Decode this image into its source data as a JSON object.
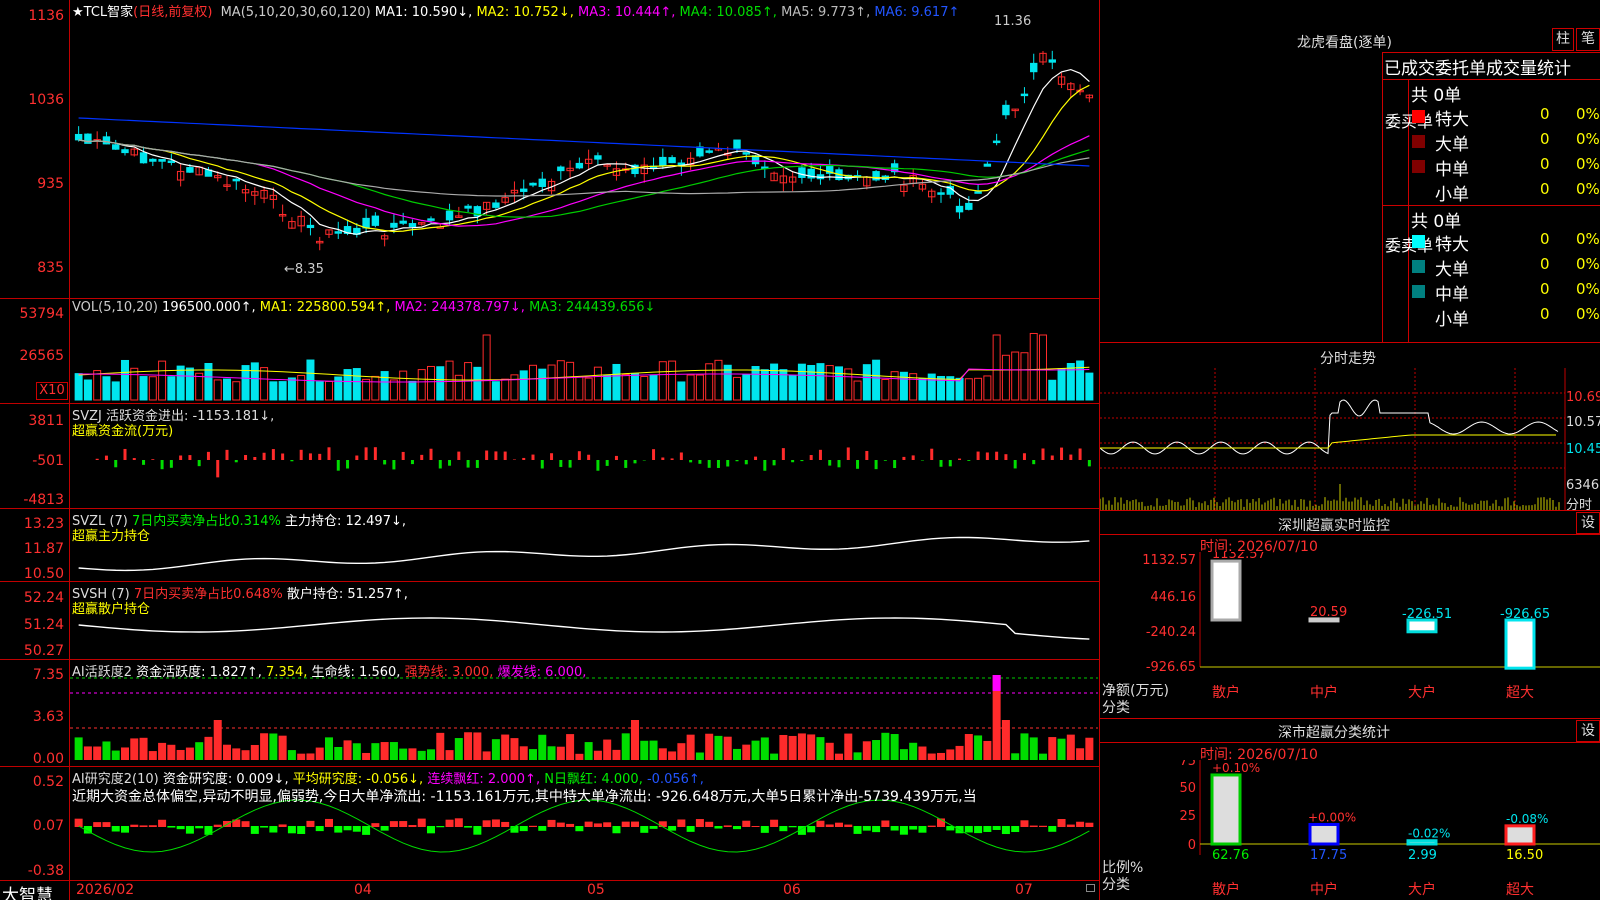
{
  "colors": {
    "up": "#ff2b2b",
    "down": "#00e5ee",
    "grid": "#c00000",
    "ma1": "#ffffff",
    "ma2": "#ffff00",
    "ma3": "#ff00ff",
    "ma4": "#00cc00",
    "ma5": "#aaaaaa",
    "ma6": "#0033ff"
  },
  "main": {
    "stock": "★TCL智家",
    "mode": "(日线,前复权)",
    "ma_label": "MA(5,10,20,30,60,120)",
    "ma1": "MA1: 10.590↓,",
    "ma2": "MA2: 10.752↓,",
    "ma3": "MA3: 10.444↑,",
    "ma4": "MA4: 10.085↑,",
    "ma5": "MA5: 9.773↑,",
    "ma6": "MA6: 9.617↑",
    "high_mark": "11.36",
    "low_mark": "←8.35",
    "yticks": [
      "1136",
      "1036",
      "935",
      "835"
    ]
  },
  "vol": {
    "label": "VOL(5,10,20)",
    "value": "196500.000↑,",
    "ma1": "MA1: 225800.594↑,",
    "ma2": "MA2: 244378.797↓,",
    "ma3": "MA3: 244439.656↓",
    "yticks": [
      "53794",
      "26565"
    ],
    "unit": "X10"
  },
  "svzj": {
    "name": "SVZJ",
    "text": "活跃资金进出: -1153.181↓,",
    "sub": "超赢资金流(万元)",
    "yticks": [
      "3811",
      "-501",
      "-4813"
    ]
  },
  "svzl": {
    "name": "SVZL (7)",
    "t1": "7日内买卖净占比0.314%",
    "t2": "主力持仓: 12.497↓,",
    "sub": "超赢主力持仓",
    "yticks": [
      "13.23",
      "11.87",
      "10.50"
    ]
  },
  "svsh": {
    "name": "SVSH (7)",
    "t1": "7日内买卖净占比0.648%",
    "t2": "散户持仓: 51.257↑,",
    "sub": "超赢散户持仓",
    "yticks": [
      "52.24",
      "51.24",
      "50.27"
    ]
  },
  "ai1": {
    "name": "AI活跃度2",
    "t1": "资金活跃度: 1.827↑,",
    "t2": "7.354,",
    "t3": "生命线: 1.560,",
    "t4": "强势线: 3.000,",
    "t5": "爆发线: 6.000,",
    "yticks": [
      "7.35",
      "3.63",
      "0.00"
    ]
  },
  "ai2": {
    "name": "AI研究度2(10)",
    "t1": "资金研究度: 0.009↓,",
    "t2": "平均研究度: -0.056↓,",
    "t3": "连续飘红: 2.000↑,",
    "t4": "N日飘红: 4.000,",
    "t5": "-0.056↑,",
    "summary": "近期大资金总体偏空,异动不明显,偏弱势,今日大单净流出: -1153.161万元,其中特大单净流出: -926.648万元,大单5日累计净出-5739.439万元,当",
    "yticks": [
      "0.52",
      "0.07",
      "-0.38"
    ]
  },
  "xaxis": {
    "brand": "大智慧",
    "labels": [
      "2026/02",
      "04",
      "05",
      "06",
      "07"
    ]
  },
  "lhb": {
    "title": "龙虎看盘(逐单)",
    "btn1": "柱",
    "btn2": "笔",
    "header": "已成交委托单成交量统计",
    "buy_label": "委买单",
    "buy_total": "共 0单",
    "sell_label": "委卖单",
    "sell_total": "共 0单",
    "rows": [
      {
        "name": "特大",
        "qty": "0",
        "pct": "0%"
      },
      {
        "name": "大单",
        "qty": "0",
        "pct": "0%"
      },
      {
        "name": "中单",
        "qty": "0",
        "pct": "0%"
      },
      {
        "name": "小单",
        "qty": "0",
        "pct": "0%"
      }
    ]
  },
  "intraday": {
    "title": "分时走势",
    "ylabels": [
      "10.69",
      "10.57",
      "10.45"
    ],
    "vol_label": "6346",
    "vol_unit": "分时"
  },
  "monitor": {
    "title": "深圳超赢实时监控",
    "btn": "设",
    "date": "时间: 2026/07/10",
    "ylabels": [
      "1132.57",
      "446.16",
      "-240.24",
      "-926.65"
    ],
    "bars": [
      {
        "cat": "散户",
        "value": 1132.57,
        "label": "1132.57"
      },
      {
        "cat": "中户",
        "value": 20.59,
        "label": "20.59"
      },
      {
        "cat": "大户",
        "value": -226.51,
        "label": "-226.51"
      },
      {
        "cat": "超大",
        "value": -926.65,
        "label": "-926.65"
      }
    ],
    "ylab1": "净额(万元)",
    "ylab2": "分类"
  },
  "classstat": {
    "title": "深市超赢分类统计",
    "btn": "设",
    "date": "时间: 2026/07/10",
    "ylabels": [
      "75",
      "50",
      "25",
      "0"
    ],
    "bars": [
      {
        "cat": "散户",
        "value": 62.76,
        "label": "62.76",
        "chg": "+0.10%"
      },
      {
        "cat": "中户",
        "value": 17.75,
        "label": "17.75",
        "chg": "+0.00%"
      },
      {
        "cat": "大户",
        "value": 2.99,
        "label": "2.99",
        "chg": "-0.02%"
      },
      {
        "cat": "超大",
        "value": 16.5,
        "label": "16.50",
        "chg": "-0.08%"
      }
    ],
    "ylab1": "比例%",
    "ylab2": "分类"
  }
}
